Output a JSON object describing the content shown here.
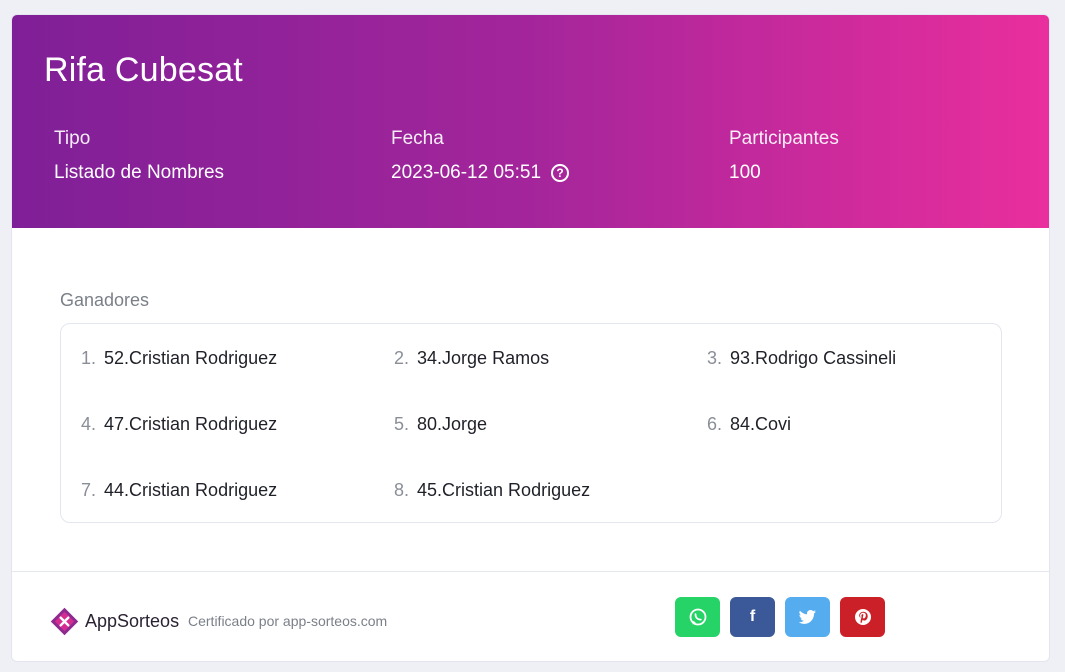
{
  "header": {
    "title": "Rifa Cubesat",
    "tipo_label": "Tipo",
    "tipo_value": "Listado de Nombres",
    "fecha_label": "Fecha",
    "fecha_value": "2023-06-12 05:51",
    "participantes_label": "Participantes",
    "participantes_value": "100"
  },
  "winners": {
    "heading": "Ganadores",
    "items": [
      {
        "idx": "1.",
        "name": "52.Cristian Rodriguez"
      },
      {
        "idx": "2.",
        "name": "34.Jorge Ramos"
      },
      {
        "idx": "3.",
        "name": "93.Rodrigo Cassineli"
      },
      {
        "idx": "4.",
        "name": "47.Cristian Rodriguez"
      },
      {
        "idx": "5.",
        "name": "80.Jorge"
      },
      {
        "idx": "6.",
        "name": "84.Covi"
      },
      {
        "idx": "7.",
        "name": "44.Cristian Rodriguez"
      },
      {
        "idx": "8.",
        "name": "45.Cristian Rodriguez"
      }
    ]
  },
  "footer": {
    "brand_app": "App",
    "brand_sorteos": "Sorteos",
    "certified": "Certificado por app-sorteos.com",
    "share": [
      {
        "icon": "whatsapp-icon",
        "color": "#25d366"
      },
      {
        "icon": "facebook-icon",
        "color": "#3b5998"
      },
      {
        "icon": "twitter-icon",
        "color": "#55acee"
      },
      {
        "icon": "pinterest-icon",
        "color": "#cb2027"
      }
    ]
  },
  "colors": {
    "header_gradient_start": "#7f1f97",
    "header_gradient_end": "#ea2e9d"
  }
}
